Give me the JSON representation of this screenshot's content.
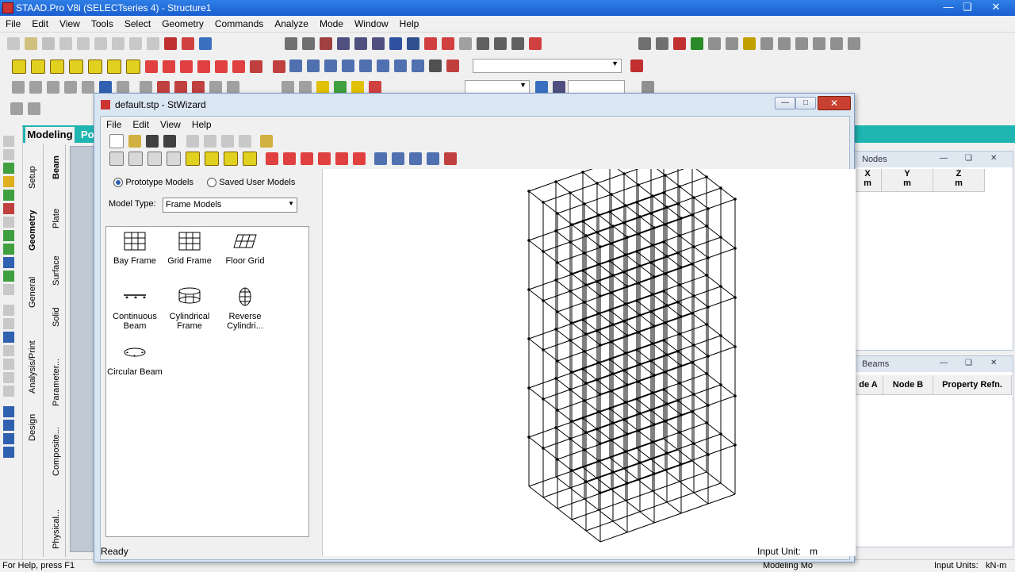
{
  "app": {
    "title": "STAAD.Pro V8i (SELECTseries 4) - Structure1",
    "menu": [
      "File",
      "Edit",
      "View",
      "Tools",
      "Select",
      "Geometry",
      "Commands",
      "Analyze",
      "Mode",
      "Window",
      "Help"
    ],
    "page_tabs": {
      "modeling": "Modeling",
      "partial": "Po"
    },
    "vtabs_outer": [
      "Setup",
      "Geometry",
      "General",
      "Analysis/Print",
      "Design"
    ],
    "vtabs_inner": [
      "Beam",
      "Plate",
      "Surface",
      "Solid",
      "Parameter...",
      "Composite...",
      "Physical..."
    ],
    "status_left": "For Help, press F1",
    "status_mode": "Modeling Mo",
    "status_units_label": "Input Units:",
    "status_units_value": "kN-m"
  },
  "nodes_panel": {
    "title": "Nodes",
    "columns": [
      {
        "label": "X",
        "unit": "m"
      },
      {
        "label": "Y",
        "unit": "m"
      },
      {
        "label": "Z",
        "unit": "m"
      }
    ]
  },
  "beams_panel": {
    "title": "Beams",
    "columns": [
      "de A",
      "Node B",
      "Property Refn."
    ]
  },
  "dialog": {
    "title": "default.stp - StWizard",
    "menu": [
      "File",
      "Edit",
      "View",
      "Help"
    ],
    "radio_prototype": "Prototype Models",
    "radio_saved": "Saved User Models",
    "model_type_label": "Model Type:",
    "model_type_value": "Frame Models",
    "models": [
      {
        "name": "Bay Frame",
        "icon": "bay-frame-icon"
      },
      {
        "name": "Grid Frame",
        "icon": "grid-frame-icon"
      },
      {
        "name": "Floor Grid",
        "icon": "floor-grid-icon"
      },
      {
        "name": "Continuous Beam",
        "icon": "continuous-beam-icon"
      },
      {
        "name": "Cylindrical Frame",
        "icon": "cylindrical-frame-icon"
      },
      {
        "name": "Reverse Cylindri...",
        "icon": "reverse-cylindrical-icon"
      },
      {
        "name": "Circular Beam",
        "icon": "circular-beam-icon"
      }
    ],
    "status_ready": "Ready",
    "input_unit_label": "Input Unit:",
    "input_unit_value": "m"
  },
  "colors": {
    "titlebar": "#1b5fd0",
    "page_control": "#1fb5b0",
    "dialog_frame": "#dbe6f3",
    "frame_lines": "#000000"
  }
}
